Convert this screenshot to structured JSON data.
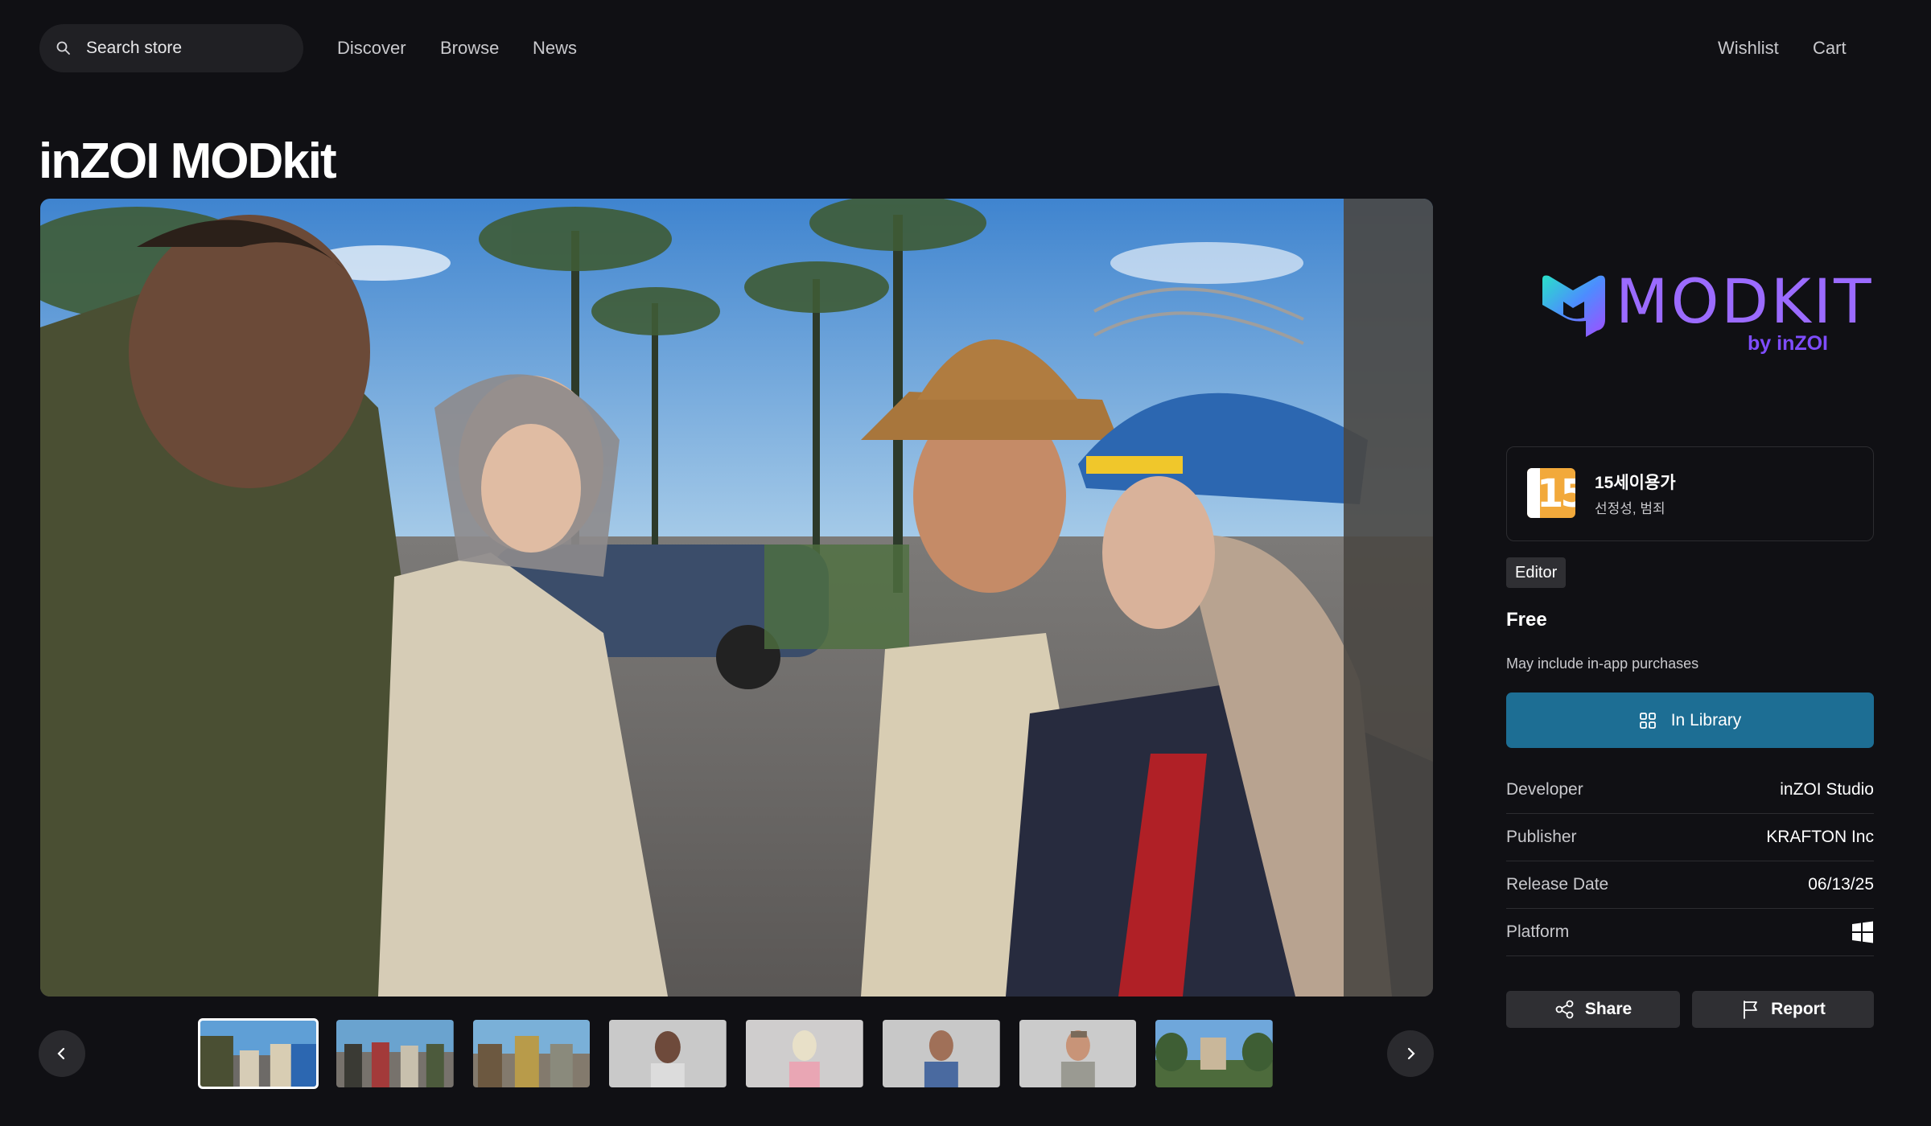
{
  "nav": {
    "search_placeholder": "Search store",
    "links": [
      "Discover",
      "Browse",
      "News"
    ],
    "wishlist": "Wishlist",
    "cart": "Cart"
  },
  "product": {
    "title": "inZOI MODkit"
  },
  "media": {
    "thumbnail_count": 8,
    "selected_index": 0
  },
  "logo": {
    "wordmark": "MODKIT",
    "byline": "by inZOI"
  },
  "rating": {
    "badge": "15",
    "title": "15세이용가",
    "descriptors": "선정성, 범죄"
  },
  "tag": "Editor",
  "price": "Free",
  "iap_note": "May include in-app purchases",
  "library_button": "In Library",
  "details": [
    {
      "label": "Developer",
      "value": "inZOI Studio"
    },
    {
      "label": "Publisher",
      "value": "KRAFTON Inc"
    },
    {
      "label": "Release Date",
      "value": "06/13/25"
    },
    {
      "label": "Platform",
      "value": ""
    }
  ],
  "actions": {
    "share": "Share",
    "report": "Report"
  },
  "colors": {
    "background": "#101014",
    "library_button": "#1d6e94",
    "logo_purple": "#9b6bff",
    "rating_orange": "#f2a93b"
  },
  "icons": [
    "search-icon",
    "grid-icon",
    "windows-icon",
    "share-icon",
    "flag-icon",
    "chevron-left-icon",
    "chevron-right-icon"
  ]
}
